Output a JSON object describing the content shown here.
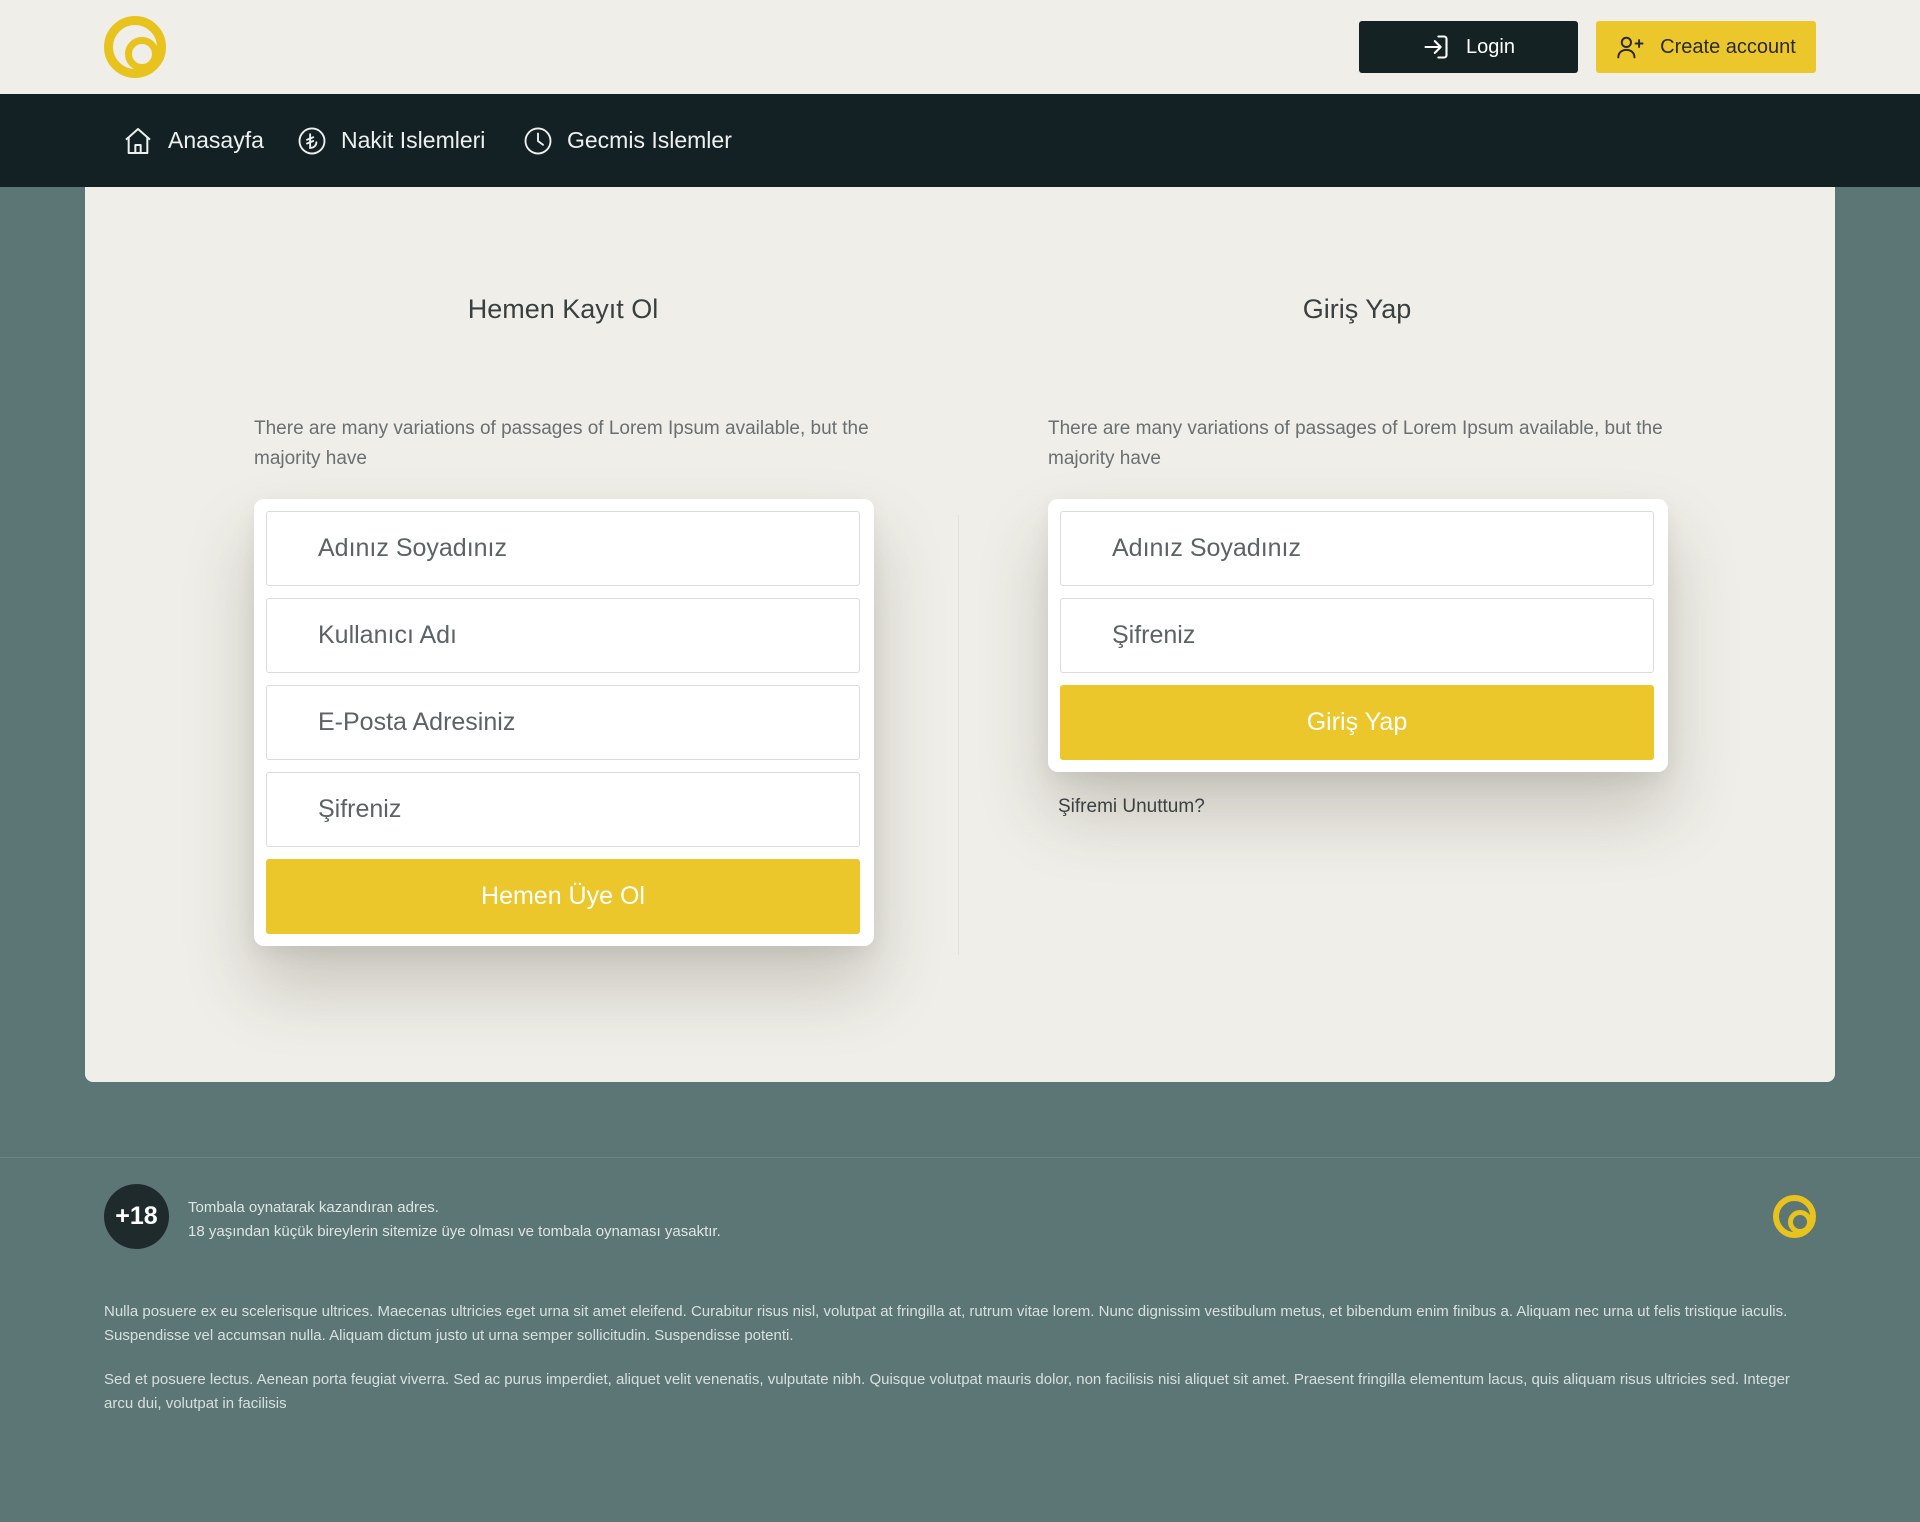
{
  "header": {
    "login_label": "Login",
    "create_account_label": "Create account"
  },
  "nav": {
    "items": [
      {
        "label": "Anasayfa",
        "icon": "home-icon"
      },
      {
        "label": "Nakit Islemleri",
        "icon": "lira-icon"
      },
      {
        "label": "Gecmis Islemler",
        "icon": "clock-icon"
      }
    ]
  },
  "register": {
    "title": "Hemen Kayıt Ol",
    "description": "There are many variations of passages of Lorem Ipsum available, but the majority have",
    "fields": [
      "Adınız Soyadınız",
      "Kullanıcı Adı",
      "E-Posta Adresiniz",
      "Şifreniz"
    ],
    "button": "Hemen Üye Ol"
  },
  "login": {
    "title": "Giriş Yap",
    "description": "There are many variations of passages of Lorem Ipsum available, but the majority have",
    "fields": [
      "Adınız Soyadınız",
      "Şifreniz"
    ],
    "button": "Giriş Yap",
    "forgot": "Şifremi Unuttum?"
  },
  "footer": {
    "age_badge": "+18",
    "tagline_1": "Tombala oynatarak kazandıran adres.",
    "tagline_2": "18 yaşından küçük bireylerin sitemize üye olması ve tombala oynaması yasaktır.",
    "paragraph_1": "Nulla posuere ex eu scelerisque ultrices. Maecenas ultricies eget urna sit amet eleifend. Curabitur risus nisl, volutpat at fringilla at, rutrum vitae lorem. Nunc dignissim vestibulum metus, et bibendum enim finibus a. Aliquam nec urna ut felis tristique iaculis. Suspendisse vel accumsan nulla. Aliquam dictum justo ut urna semper sollicitudin. Suspendisse potenti.",
    "paragraph_2": "Sed et posuere lectus. Aenean porta feugiat viverra. Sed ac purus imperdiet, aliquet velit venenatis, vulputate nibh. Quisque volutpat mauris dolor, non facilisis nisi aliquet sit amet. Praesent fringilla elementum lacus, quis aliquam risus ultricies sed. Integer arcu dui, volutpat in facilisis"
  },
  "colors": {
    "accent": "#ecc72c",
    "dark": "#142124",
    "page_bg": "#5b7675",
    "card_bg": "#efeee8"
  }
}
